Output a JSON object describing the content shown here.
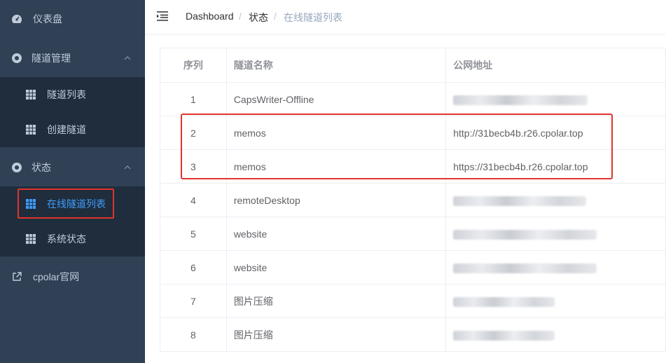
{
  "sidebar": {
    "items": [
      {
        "label": "仪表盘",
        "icon": "dashboard-icon"
      },
      {
        "label": "隧道管理",
        "icon": "tunnel-icon"
      },
      {
        "label": "隧道列表",
        "icon": "grid-icon"
      },
      {
        "label": "创建隧道",
        "icon": "grid-icon"
      },
      {
        "label": "状态",
        "icon": "status-icon"
      },
      {
        "label": "在线隧道列表",
        "icon": "grid-icon"
      },
      {
        "label": "系统状态",
        "icon": "grid-icon"
      },
      {
        "label": "cpolar官网",
        "icon": "external-link-icon"
      }
    ],
    "active_color": "#409eff"
  },
  "breadcrumb": {
    "items": [
      "Dashboard",
      "状态",
      "在线隧道列表"
    ],
    "separator": "/"
  },
  "table": {
    "headers": [
      "序列",
      "隧道名称",
      "公网地址"
    ],
    "rows": [
      {
        "index": "1",
        "name": "CapsWriter-Offline",
        "url": ""
      },
      {
        "index": "2",
        "name": "memos",
        "url": "http://31becb4b.r26.cpolar.top"
      },
      {
        "index": "3",
        "name": "memos",
        "url": "https://31becb4b.r26.cpolar.top"
      },
      {
        "index": "4",
        "name": "remoteDesktop",
        "url": ""
      },
      {
        "index": "5",
        "name": "website",
        "url": ""
      },
      {
        "index": "6",
        "name": "website",
        "url": ""
      },
      {
        "index": "7",
        "name": "图片压缩",
        "url": ""
      },
      {
        "index": "8",
        "name": "图片压缩",
        "url": ""
      }
    ]
  },
  "colors": {
    "sidebar_bg": "#304156",
    "submenu_bg": "#1f2d3d",
    "highlight": "#e0342c"
  }
}
